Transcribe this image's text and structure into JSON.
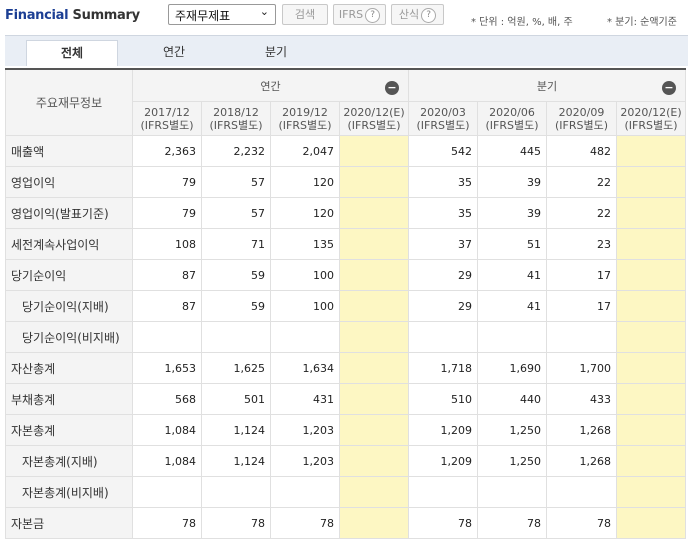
{
  "header": {
    "title_part1": "Financial",
    "title_part2": "Summary",
    "select_value": "주재무제표",
    "search_label": "검색",
    "ifrs_label": "IFRS",
    "formula_label": "산식",
    "help_glyph": "?",
    "unit_note": "* 단위 : 억원, %, 배, 주",
    "quarter_note": "* 분기: 순액기준"
  },
  "tabs": [
    {
      "label": "전체",
      "active": true
    },
    {
      "label": "연간",
      "active": false
    },
    {
      "label": "분기",
      "active": false
    }
  ],
  "table": {
    "corner_label": "주요재무정보",
    "group_annual": "연간",
    "group_quarter": "분기",
    "collapse_glyph": "−",
    "periods": [
      {
        "period": "2017/12",
        "basis": "(IFRS별도)"
      },
      {
        "period": "2018/12",
        "basis": "(IFRS별도)"
      },
      {
        "period": "2019/12",
        "basis": "(IFRS별도)"
      },
      {
        "period": "2020/12(E)",
        "basis": "(IFRS별도)"
      },
      {
        "period": "2020/03",
        "basis": "(IFRS별도)"
      },
      {
        "period": "2020/06",
        "basis": "(IFRS별도)"
      },
      {
        "period": "2020/09",
        "basis": "(IFRS별도)"
      },
      {
        "period": "2020/12(E)",
        "basis": "(IFRS별도)"
      }
    ],
    "rows": [
      {
        "label": "매출액",
        "values": [
          "2,363",
          "2,232",
          "2,047",
          "",
          "542",
          "445",
          "482",
          ""
        ]
      },
      {
        "label": "영업이익",
        "values": [
          "79",
          "57",
          "120",
          "",
          "35",
          "39",
          "22",
          ""
        ]
      },
      {
        "label": "영업이익(발표기준)",
        "values": [
          "79",
          "57",
          "120",
          "",
          "35",
          "39",
          "22",
          ""
        ]
      },
      {
        "label": "세전계속사업이익",
        "values": [
          "108",
          "71",
          "135",
          "",
          "37",
          "51",
          "23",
          ""
        ]
      },
      {
        "label": "당기순이익",
        "values": [
          "87",
          "59",
          "100",
          "",
          "29",
          "41",
          "17",
          ""
        ]
      },
      {
        "label": "당기순이익(지배)",
        "values": [
          "87",
          "59",
          "100",
          "",
          "29",
          "41",
          "17",
          ""
        ]
      },
      {
        "label": "당기순이익(비지배)",
        "values": [
          "",
          "",
          "",
          "",
          "",
          "",
          "",
          ""
        ]
      },
      {
        "label": "자산총계",
        "values": [
          "1,653",
          "1,625",
          "1,634",
          "",
          "1,718",
          "1,690",
          "1,700",
          ""
        ]
      },
      {
        "label": "부채총계",
        "values": [
          "568",
          "501",
          "431",
          "",
          "510",
          "440",
          "433",
          ""
        ]
      },
      {
        "label": "자본총계",
        "values": [
          "1,084",
          "1,124",
          "1,203",
          "",
          "1,209",
          "1,250",
          "1,268",
          ""
        ]
      },
      {
        "label": "자본총계(지배)",
        "values": [
          "1,084",
          "1,124",
          "1,203",
          "",
          "1,209",
          "1,250",
          "1,268",
          ""
        ]
      },
      {
        "label": "자본총계(비지배)",
        "values": [
          "",
          "",
          "",
          "",
          "",
          "",
          "",
          ""
        ]
      },
      {
        "label": "자본금",
        "values": [
          "78",
          "78",
          "78",
          "",
          "78",
          "78",
          "78",
          ""
        ]
      }
    ]
  }
}
